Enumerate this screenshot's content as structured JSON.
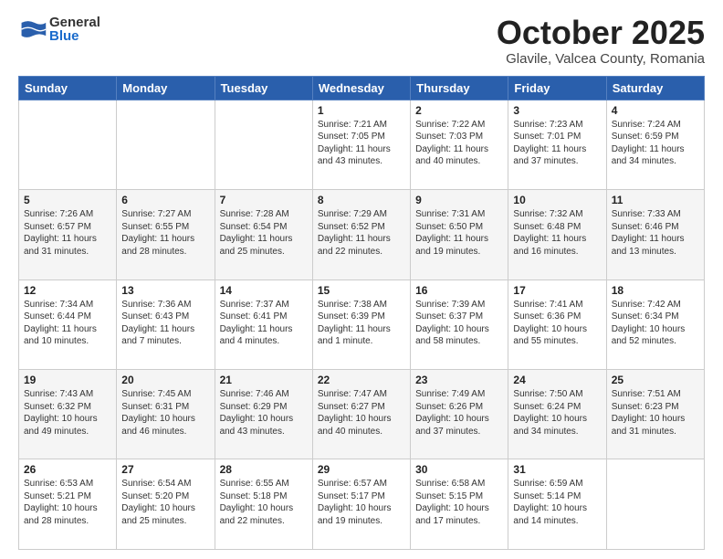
{
  "header": {
    "logo_general": "General",
    "logo_blue": "Blue",
    "month": "October 2025",
    "location": "Glavile, Valcea County, Romania"
  },
  "days_of_week": [
    "Sunday",
    "Monday",
    "Tuesday",
    "Wednesday",
    "Thursday",
    "Friday",
    "Saturday"
  ],
  "weeks": [
    [
      {
        "day": "",
        "info": ""
      },
      {
        "day": "",
        "info": ""
      },
      {
        "day": "",
        "info": ""
      },
      {
        "day": "1",
        "info": "Sunrise: 7:21 AM\nSunset: 7:05 PM\nDaylight: 11 hours and 43 minutes."
      },
      {
        "day": "2",
        "info": "Sunrise: 7:22 AM\nSunset: 7:03 PM\nDaylight: 11 hours and 40 minutes."
      },
      {
        "day": "3",
        "info": "Sunrise: 7:23 AM\nSunset: 7:01 PM\nDaylight: 11 hours and 37 minutes."
      },
      {
        "day": "4",
        "info": "Sunrise: 7:24 AM\nSunset: 6:59 PM\nDaylight: 11 hours and 34 minutes."
      }
    ],
    [
      {
        "day": "5",
        "info": "Sunrise: 7:26 AM\nSunset: 6:57 PM\nDaylight: 11 hours and 31 minutes."
      },
      {
        "day": "6",
        "info": "Sunrise: 7:27 AM\nSunset: 6:55 PM\nDaylight: 11 hours and 28 minutes."
      },
      {
        "day": "7",
        "info": "Sunrise: 7:28 AM\nSunset: 6:54 PM\nDaylight: 11 hours and 25 minutes."
      },
      {
        "day": "8",
        "info": "Sunrise: 7:29 AM\nSunset: 6:52 PM\nDaylight: 11 hours and 22 minutes."
      },
      {
        "day": "9",
        "info": "Sunrise: 7:31 AM\nSunset: 6:50 PM\nDaylight: 11 hours and 19 minutes."
      },
      {
        "day": "10",
        "info": "Sunrise: 7:32 AM\nSunset: 6:48 PM\nDaylight: 11 hours and 16 minutes."
      },
      {
        "day": "11",
        "info": "Sunrise: 7:33 AM\nSunset: 6:46 PM\nDaylight: 11 hours and 13 minutes."
      }
    ],
    [
      {
        "day": "12",
        "info": "Sunrise: 7:34 AM\nSunset: 6:44 PM\nDaylight: 11 hours and 10 minutes."
      },
      {
        "day": "13",
        "info": "Sunrise: 7:36 AM\nSunset: 6:43 PM\nDaylight: 11 hours and 7 minutes."
      },
      {
        "day": "14",
        "info": "Sunrise: 7:37 AM\nSunset: 6:41 PM\nDaylight: 11 hours and 4 minutes."
      },
      {
        "day": "15",
        "info": "Sunrise: 7:38 AM\nSunset: 6:39 PM\nDaylight: 11 hours and 1 minute."
      },
      {
        "day": "16",
        "info": "Sunrise: 7:39 AM\nSunset: 6:37 PM\nDaylight: 10 hours and 58 minutes."
      },
      {
        "day": "17",
        "info": "Sunrise: 7:41 AM\nSunset: 6:36 PM\nDaylight: 10 hours and 55 minutes."
      },
      {
        "day": "18",
        "info": "Sunrise: 7:42 AM\nSunset: 6:34 PM\nDaylight: 10 hours and 52 minutes."
      }
    ],
    [
      {
        "day": "19",
        "info": "Sunrise: 7:43 AM\nSunset: 6:32 PM\nDaylight: 10 hours and 49 minutes."
      },
      {
        "day": "20",
        "info": "Sunrise: 7:45 AM\nSunset: 6:31 PM\nDaylight: 10 hours and 46 minutes."
      },
      {
        "day": "21",
        "info": "Sunrise: 7:46 AM\nSunset: 6:29 PM\nDaylight: 10 hours and 43 minutes."
      },
      {
        "day": "22",
        "info": "Sunrise: 7:47 AM\nSunset: 6:27 PM\nDaylight: 10 hours and 40 minutes."
      },
      {
        "day": "23",
        "info": "Sunrise: 7:49 AM\nSunset: 6:26 PM\nDaylight: 10 hours and 37 minutes."
      },
      {
        "day": "24",
        "info": "Sunrise: 7:50 AM\nSunset: 6:24 PM\nDaylight: 10 hours and 34 minutes."
      },
      {
        "day": "25",
        "info": "Sunrise: 7:51 AM\nSunset: 6:23 PM\nDaylight: 10 hours and 31 minutes."
      }
    ],
    [
      {
        "day": "26",
        "info": "Sunrise: 6:53 AM\nSunset: 5:21 PM\nDaylight: 10 hours and 28 minutes."
      },
      {
        "day": "27",
        "info": "Sunrise: 6:54 AM\nSunset: 5:20 PM\nDaylight: 10 hours and 25 minutes."
      },
      {
        "day": "28",
        "info": "Sunrise: 6:55 AM\nSunset: 5:18 PM\nDaylight: 10 hours and 22 minutes."
      },
      {
        "day": "29",
        "info": "Sunrise: 6:57 AM\nSunset: 5:17 PM\nDaylight: 10 hours and 19 minutes."
      },
      {
        "day": "30",
        "info": "Sunrise: 6:58 AM\nSunset: 5:15 PM\nDaylight: 10 hours and 17 minutes."
      },
      {
        "day": "31",
        "info": "Sunrise: 6:59 AM\nSunset: 5:14 PM\nDaylight: 10 hours and 14 minutes."
      },
      {
        "day": "",
        "info": ""
      }
    ]
  ]
}
